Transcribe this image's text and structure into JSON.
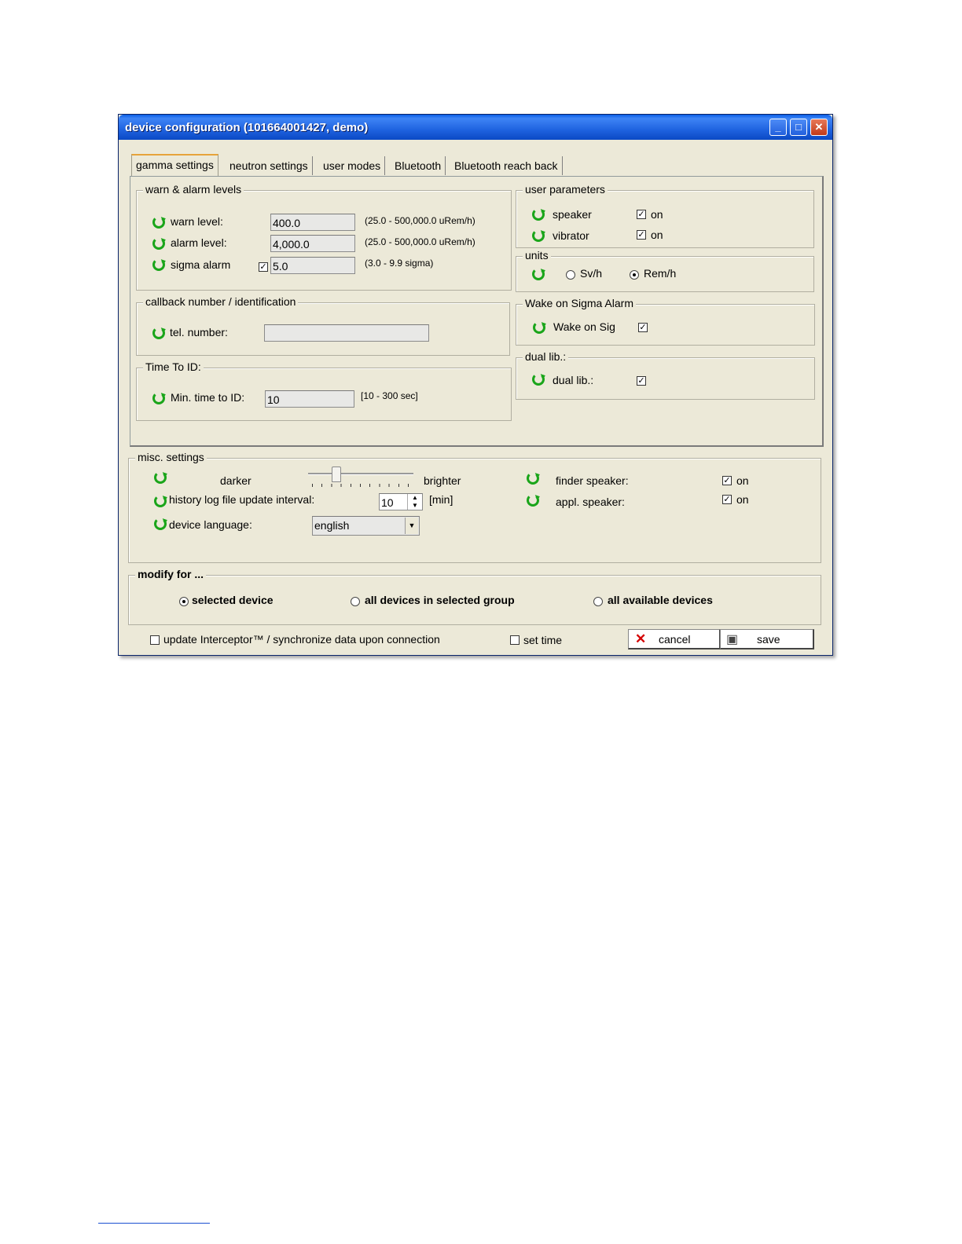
{
  "window": {
    "title": "device configuration  (101664001427, demo)",
    "controls": [
      "minimize-icon",
      "maximize-icon",
      "close-icon"
    ]
  },
  "tabs": [
    {
      "label": "gamma settings",
      "active": true
    },
    {
      "label": "neutron settings",
      "active": false
    },
    {
      "label": "user modes",
      "active": false
    },
    {
      "label": "Bluetooth",
      "active": false
    },
    {
      "label": "Bluetooth reach back",
      "active": false
    }
  ],
  "warn_alarm": {
    "title": "warn & alarm levels",
    "warn_label": "warn level:",
    "warn_value": "400.0",
    "warn_range": "(25.0 - 500,000.0 uRem/h)",
    "alarm_label": "alarm level:",
    "alarm_value": "4,000.0",
    "alarm_range": "(25.0 - 500,000.0 uRem/h)",
    "sigma_label": "sigma alarm",
    "sigma_checked": true,
    "sigma_value": "5.0",
    "sigma_range": "(3.0 - 9.9 sigma)"
  },
  "callback": {
    "title": "callback number / identification",
    "tel_label": "tel. number:",
    "tel_value": ""
  },
  "time_to_id": {
    "title": "Time To ID:",
    "label": "Min. time to ID:",
    "value": "10",
    "range": "[10 - 300 sec]"
  },
  "user_params": {
    "title": "user parameters",
    "speaker_label": "speaker",
    "speaker_on": "on",
    "vibrator_label": "vibrator",
    "vibrator_on": "on"
  },
  "units": {
    "title": "units",
    "opt1": "Sv/h",
    "opt2": "Rem/h",
    "selected": "Rem/h"
  },
  "wake": {
    "title": "Wake on Sigma Alarm",
    "label": "Wake on Sig"
  },
  "dual": {
    "title": "dual lib.:",
    "label": "dual lib.:"
  },
  "misc": {
    "title": "misc. settings",
    "darker": "darker",
    "brighter": "brighter",
    "history_label": "history log file update interval:",
    "history_value": "10",
    "history_unit": "[min]",
    "language_label": "device language:",
    "language_value": "english",
    "finder_label": "finder speaker:",
    "finder_on": "on",
    "appl_label": "appl. speaker:",
    "appl_on": "on"
  },
  "modify": {
    "title": "modify for ...",
    "opt1": "selected device",
    "opt2": "all devices in selected group",
    "opt3": "all available devices",
    "selected": "selected device"
  },
  "footer": {
    "update_label": "update Interceptor™ / synchronize data upon connection",
    "settime_label": "set time",
    "cancel_label": "cancel",
    "save_label": "save"
  }
}
